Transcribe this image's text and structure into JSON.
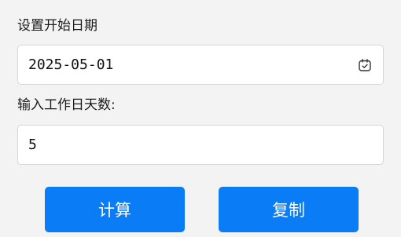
{
  "form": {
    "start_date_label": "设置开始日期",
    "start_date_value": "2025-05-01",
    "workdays_label": "输入工作日天数:",
    "workdays_value": "5"
  },
  "actions": {
    "calculate_label": "计算",
    "copy_label": "复制"
  },
  "icons": {
    "date_picker": "calendar-icon"
  },
  "colors": {
    "primary": "#0a7cf6",
    "background": "#f3f3f3",
    "field_border": "#d6d6d6"
  }
}
